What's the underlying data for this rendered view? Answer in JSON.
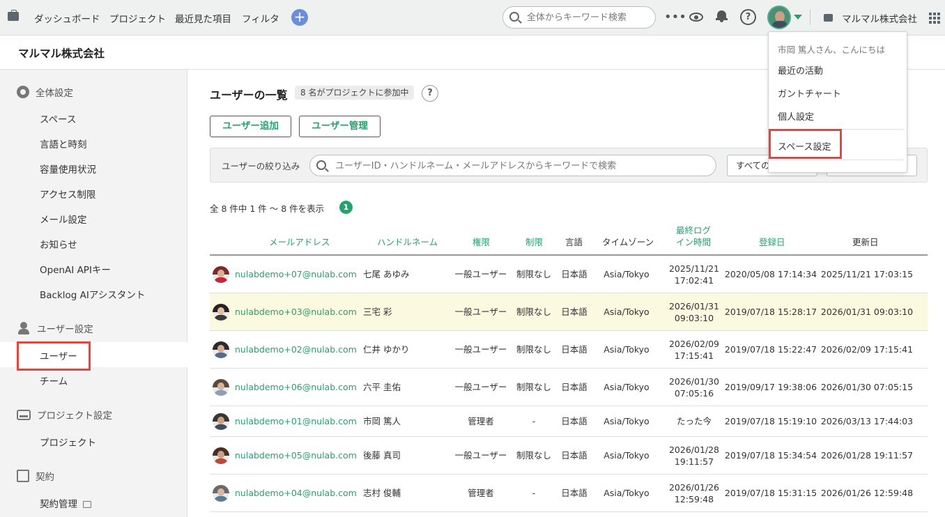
{
  "topnav": {
    "links": [
      "ダッシュボード",
      "プロジェクト",
      "最近見た項目",
      "フィルタ"
    ],
    "plus_label": "+",
    "search_placeholder": "全体からキーワード検索",
    "more_label": "•••",
    "help_label": "?",
    "company_name": "マルマル株式会社"
  },
  "header": {
    "space_title": "マルマル株式会社"
  },
  "sidebar": {
    "sections": [
      {
        "label": "全体設定",
        "icon": "gear-icon",
        "items": [
          "スペース",
          "言語と時刻",
          "容量使用状況",
          "アクセス制限",
          "メール設定",
          "お知らせ",
          "OpenAI APIキー",
          "Backlog AIアシスタント"
        ]
      },
      {
        "label": "ユーザー設定",
        "icon": "user-icon",
        "items": [
          "ユーザー",
          "チーム"
        ]
      },
      {
        "label": "プロジェクト設定",
        "icon": "tray-icon",
        "items": [
          "プロジェクト"
        ]
      },
      {
        "label": "契約",
        "icon": "contract-icon",
        "items": [
          "契約管理"
        ]
      }
    ],
    "active_item": "ユーザー"
  },
  "main": {
    "title": "ユーザーの一覧",
    "count_badge": "8 名がプロジェクトに参加中",
    "help_label": "?",
    "buttons": {
      "add_user": "ユーザー追加",
      "manage_users": "ユーザー管理"
    },
    "filter": {
      "label": "ユーザーの絞り込み",
      "placeholder": "ユーザーID・ハンドルネーム・メールアドレスからキーワードで検索",
      "select_value": "すべての"
    },
    "summary": "全 8 件中 1 件 〜 8 件を表示",
    "page_number": "1"
  },
  "table": {
    "columns": {
      "email": "メールアドレス",
      "handle": "ハンドルネーム",
      "role": "権限",
      "limit": "制限",
      "lang": "言語",
      "tz": "タイムゾーン",
      "last_login_1": "最終ログ",
      "last_login_2": "イン時間",
      "registered": "登録日",
      "updated": "更新日"
    },
    "rows": [
      {
        "email": "nulabdemo+07@nulab.com",
        "handle": "七尾 あゆみ",
        "role": "一般ユーザー",
        "limit": "制限なし",
        "lang": "日本語",
        "tz": "Asia/Tokyo",
        "login1": "2025/11/21",
        "login2": "17:02:41",
        "registered": "2020/05/08 17:14:34",
        "updated": "2025/11/21 17:03:15"
      },
      {
        "email": "nulabdemo+03@nulab.com",
        "handle": "三宅 彩",
        "role": "一般ユーザー",
        "limit": "制限なし",
        "lang": "日本語",
        "tz": "Asia/Tokyo",
        "login1": "2026/01/31",
        "login2": "09:03:10",
        "registered": "2019/07/18 15:28:17",
        "updated": "2026/01/31 09:03:10"
      },
      {
        "email": "nulabdemo+02@nulab.com",
        "handle": "仁井 ゆかり",
        "role": "一般ユーザー",
        "limit": "制限なし",
        "lang": "日本語",
        "tz": "Asia/Tokyo",
        "login1": "2026/02/09",
        "login2": "17:15:41",
        "registered": "2019/07/18 15:22:47",
        "updated": "2026/02/09 17:15:41"
      },
      {
        "email": "nulabdemo+06@nulab.com",
        "handle": "六平 圭佑",
        "role": "一般ユーザー",
        "limit": "制限なし",
        "lang": "日本語",
        "tz": "Asia/Tokyo",
        "login1": "2026/01/30",
        "login2": "07:05:16",
        "registered": "2019/09/17 19:38:06",
        "updated": "2026/01/30 07:05:15"
      },
      {
        "email": "nulabdemo+01@nulab.com",
        "handle": "市岡 篤人",
        "role": "管理者",
        "limit": "-",
        "lang": "日本語",
        "tz": "Asia/Tokyo",
        "login1": "たった今",
        "login2": "",
        "registered": "2019/07/18 15:19:10",
        "updated": "2026/03/13 17:44:03"
      },
      {
        "email": "nulabdemo+05@nulab.com",
        "handle": "後藤 真司",
        "role": "一般ユーザー",
        "limit": "制限なし",
        "lang": "日本語",
        "tz": "Asia/Tokyo",
        "login1": "2026/01/28",
        "login2": "19:11:57",
        "registered": "2019/07/18 15:34:54",
        "updated": "2026/01/28 19:11:57"
      },
      {
        "email": "nulabdemo+04@nulab.com",
        "handle": "志村 俊輔",
        "role": "管理者",
        "limit": "-",
        "lang": "日本語",
        "tz": "Asia/Tokyo",
        "login1": "2026/01/26",
        "login2": "12:59:48",
        "registered": "2019/07/18 15:31:15",
        "updated": "2026/01/26 12:59:48"
      }
    ]
  },
  "user_menu": {
    "greeting": "市岡 篤人さん、こんにちは",
    "items": [
      "最近の活動",
      "ガントチャート",
      "個人設定"
    ],
    "space_settings": "スペース設定"
  },
  "colors": {
    "accent": "#27a170",
    "highlight_box": "#e8443a",
    "row_highlight": "#fbf9e0"
  }
}
